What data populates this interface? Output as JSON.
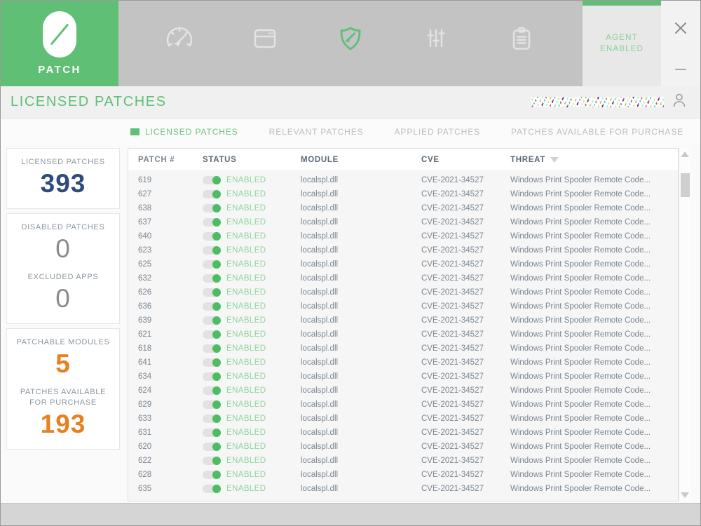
{
  "brand": {
    "name": "PATCH",
    "logo_icon": "patch-pill-slash-logo"
  },
  "nav": {
    "items": [
      {
        "icon": "gauge-icon",
        "active": false
      },
      {
        "icon": "window-icon",
        "active": false
      },
      {
        "icon": "shield-icon",
        "active": true
      },
      {
        "icon": "sliders-icon",
        "active": false
      },
      {
        "icon": "clipboard-icon",
        "active": false
      }
    ]
  },
  "agent": {
    "status_line1": "AGENT",
    "status_line2": "ENABLED",
    "accent": "#5fbf75"
  },
  "window_controls": {
    "close_icon": "close-icon",
    "minimize_icon": "minimize-icon"
  },
  "header": {
    "title": "LICENSED PATCHES",
    "title_color": "#5fbf75",
    "user_icon": "user-icon",
    "username_redacted": true
  },
  "tabs": [
    {
      "label": "LICENSED PATCHES",
      "active": true
    },
    {
      "label": "RELEVANT PATCHES",
      "active": false
    },
    {
      "label": "APPLIED PATCHES",
      "active": false
    },
    {
      "label": "PATCHES AVAILABLE FOR PURCHASE",
      "active": false
    }
  ],
  "sidebar": {
    "cards": [
      {
        "stats": [
          {
            "label": "LICENSED PATCHES",
            "value": "393",
            "color": "navy"
          }
        ]
      },
      {
        "stats": [
          {
            "label": "DISABLED PATCHES",
            "value": "0",
            "color": "gray"
          },
          {
            "label": "EXCLUDED APPS",
            "value": "0",
            "color": "gray"
          }
        ]
      },
      {
        "stats": [
          {
            "label": "PATCHABLE MODULES",
            "value": "5",
            "color": "orange"
          },
          {
            "label": "PATCHES AVAILABLE FOR PURCHASE",
            "value": "193",
            "color": "orange"
          }
        ]
      }
    ]
  },
  "table": {
    "columns": [
      {
        "key": "patch",
        "label": "PATCH #",
        "sorted": false
      },
      {
        "key": "status",
        "label": "STATUS",
        "sorted": false
      },
      {
        "key": "module",
        "label": "MODULE",
        "sorted": false
      },
      {
        "key": "cve",
        "label": "CVE",
        "sorted": false
      },
      {
        "key": "threat",
        "label": "THREAT",
        "sorted": true
      }
    ],
    "rows": [
      {
        "patch": "619",
        "status": "ENABLED",
        "enabled": true,
        "module": "localspl.dll",
        "cve": "CVE-2021-34527",
        "threat": "Windows Print Spooler Remote Code..."
      },
      {
        "patch": "627",
        "status": "ENABLED",
        "enabled": true,
        "module": "localspl.dll",
        "cve": "CVE-2021-34527",
        "threat": "Windows Print Spooler Remote Code..."
      },
      {
        "patch": "638",
        "status": "ENABLED",
        "enabled": true,
        "module": "localspl.dll",
        "cve": "CVE-2021-34527",
        "threat": "Windows Print Spooler Remote Code..."
      },
      {
        "patch": "637",
        "status": "ENABLED",
        "enabled": true,
        "module": "localspl.dll",
        "cve": "CVE-2021-34527",
        "threat": "Windows Print Spooler Remote Code..."
      },
      {
        "patch": "640",
        "status": "ENABLED",
        "enabled": true,
        "module": "localspl.dll",
        "cve": "CVE-2021-34527",
        "threat": "Windows Print Spooler Remote Code..."
      },
      {
        "patch": "623",
        "status": "ENABLED",
        "enabled": true,
        "module": "localspl.dll",
        "cve": "CVE-2021-34527",
        "threat": "Windows Print Spooler Remote Code..."
      },
      {
        "patch": "625",
        "status": "ENABLED",
        "enabled": true,
        "module": "localspl.dll",
        "cve": "CVE-2021-34527",
        "threat": "Windows Print Spooler Remote Code..."
      },
      {
        "patch": "632",
        "status": "ENABLED",
        "enabled": true,
        "module": "localspl.dll",
        "cve": "CVE-2021-34527",
        "threat": "Windows Print Spooler Remote Code..."
      },
      {
        "patch": "626",
        "status": "ENABLED",
        "enabled": true,
        "module": "localspl.dll",
        "cve": "CVE-2021-34527",
        "threat": "Windows Print Spooler Remote Code..."
      },
      {
        "patch": "636",
        "status": "ENABLED",
        "enabled": true,
        "module": "localspl.dll",
        "cve": "CVE-2021-34527",
        "threat": "Windows Print Spooler Remote Code..."
      },
      {
        "patch": "639",
        "status": "ENABLED",
        "enabled": true,
        "module": "localspl.dll",
        "cve": "CVE-2021-34527",
        "threat": "Windows Print Spooler Remote Code..."
      },
      {
        "patch": "621",
        "status": "ENABLED",
        "enabled": true,
        "module": "localspl.dll",
        "cve": "CVE-2021-34527",
        "threat": "Windows Print Spooler Remote Code..."
      },
      {
        "patch": "618",
        "status": "ENABLED",
        "enabled": true,
        "module": "localspl.dll",
        "cve": "CVE-2021-34527",
        "threat": "Windows Print Spooler Remote Code..."
      },
      {
        "patch": "641",
        "status": "ENABLED",
        "enabled": true,
        "module": "localspl.dll",
        "cve": "CVE-2021-34527",
        "threat": "Windows Print Spooler Remote Code..."
      },
      {
        "patch": "634",
        "status": "ENABLED",
        "enabled": true,
        "module": "localspl.dll",
        "cve": "CVE-2021-34527",
        "threat": "Windows Print Spooler Remote Code..."
      },
      {
        "patch": "624",
        "status": "ENABLED",
        "enabled": true,
        "module": "localspl.dll",
        "cve": "CVE-2021-34527",
        "threat": "Windows Print Spooler Remote Code..."
      },
      {
        "patch": "629",
        "status": "ENABLED",
        "enabled": true,
        "module": "localspl.dll",
        "cve": "CVE-2021-34527",
        "threat": "Windows Print Spooler Remote Code..."
      },
      {
        "patch": "633",
        "status": "ENABLED",
        "enabled": true,
        "module": "localspl.dll",
        "cve": "CVE-2021-34527",
        "threat": "Windows Print Spooler Remote Code..."
      },
      {
        "patch": "631",
        "status": "ENABLED",
        "enabled": true,
        "module": "localspl.dll",
        "cve": "CVE-2021-34527",
        "threat": "Windows Print Spooler Remote Code..."
      },
      {
        "patch": "620",
        "status": "ENABLED",
        "enabled": true,
        "module": "localspl.dll",
        "cve": "CVE-2021-34527",
        "threat": "Windows Print Spooler Remote Code..."
      },
      {
        "patch": "622",
        "status": "ENABLED",
        "enabled": true,
        "module": "localspl.dll",
        "cve": "CVE-2021-34527",
        "threat": "Windows Print Spooler Remote Code..."
      },
      {
        "patch": "628",
        "status": "ENABLED",
        "enabled": true,
        "module": "localspl.dll",
        "cve": "CVE-2021-34527",
        "threat": "Windows Print Spooler Remote Code..."
      },
      {
        "patch": "635",
        "status": "ENABLED",
        "enabled": true,
        "module": "localspl.dll",
        "cve": "CVE-2021-34527",
        "threat": "Windows Print Spooler Remote Code..."
      }
    ]
  },
  "scrollbar": {
    "up_icon": "scroll-up-arrow-icon",
    "down_icon": "scroll-down-arrow-icon"
  }
}
